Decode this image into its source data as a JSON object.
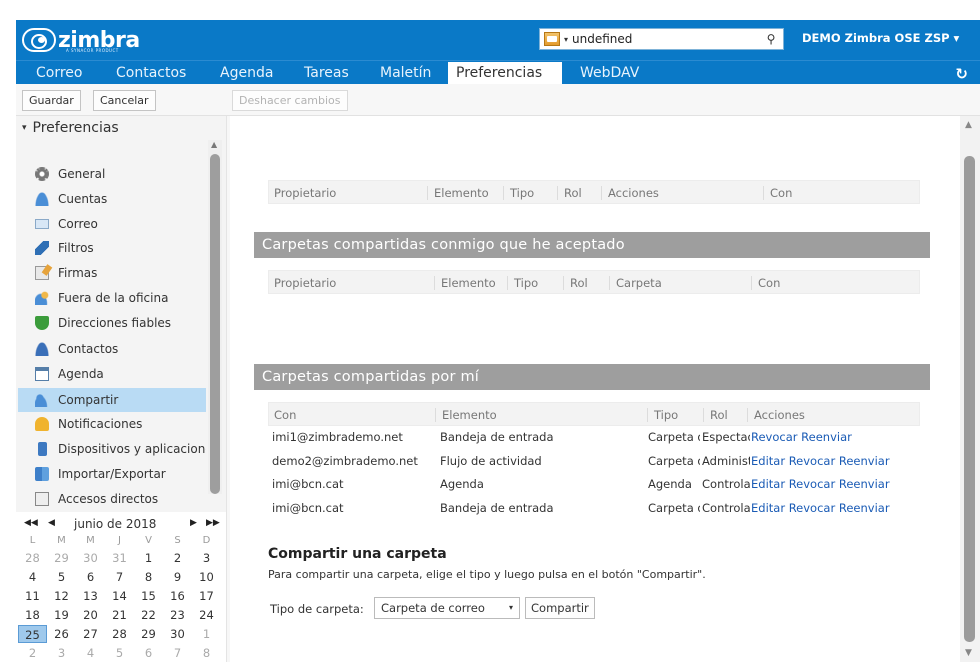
{
  "header": {
    "logo_text": "zimbra",
    "logo_sub": "A SYNACOR PRODUCT",
    "search_value": "undefined",
    "user": "DEMO Zimbra OSE ZSP",
    "user_caret": "▾",
    "refresh_glyph": "↻",
    "search_caret": "▾",
    "search_icon": "⚲"
  },
  "tabs": [
    "Correo",
    "Contactos",
    "Agenda",
    "Tareas",
    "Maletín",
    "Preferencias",
    "WebDAV"
  ],
  "toolbar": {
    "save": "Guardar",
    "cancel": "Cancelar",
    "undo": "Deshacer cambios"
  },
  "sidebar": {
    "root_arrow": "▾",
    "root": "Preferencias",
    "items": [
      {
        "label": "General",
        "icon": "gear-icon"
      },
      {
        "label": "Cuentas",
        "icon": "accounts-icon"
      },
      {
        "label": "Correo",
        "icon": "mail-icon"
      },
      {
        "label": "Filtros",
        "icon": "filter-icon"
      },
      {
        "label": "Firmas",
        "icon": "signature-icon"
      },
      {
        "label": "Fuera de la oficina",
        "icon": "out-of-office-icon"
      },
      {
        "label": "Direcciones fiables",
        "icon": "shield-icon"
      },
      {
        "label": "Contactos",
        "icon": "contacts-icon"
      },
      {
        "label": "Agenda",
        "icon": "calendar-icon"
      },
      {
        "label": "Compartir",
        "icon": "share-icon"
      },
      {
        "label": "Notificaciones",
        "icon": "bell-icon"
      },
      {
        "label": "Dispositivos y aplicaciones",
        "icon": "mobile-icon"
      },
      {
        "label": "Importar/Exportar",
        "icon": "import-export-icon"
      },
      {
        "label": "Accesos directos",
        "icon": "shortcuts-icon"
      }
    ],
    "scroll_up": "▲"
  },
  "minical": {
    "month": "junio de 2018",
    "prev_year": "◀◀",
    "prev_month": "◀",
    "next_month": "▶",
    "next_year": "▶▶",
    "weekdays": [
      "L",
      "M",
      "M",
      "J",
      "V",
      "S",
      "D"
    ],
    "weeks": [
      [
        {
          "d": "28",
          "om": true
        },
        {
          "d": "29",
          "om": true
        },
        {
          "d": "30",
          "om": true
        },
        {
          "d": "31",
          "om": true
        },
        {
          "d": "1"
        },
        {
          "d": "2"
        },
        {
          "d": "3"
        }
      ],
      [
        {
          "d": "4"
        },
        {
          "d": "5"
        },
        {
          "d": "6"
        },
        {
          "d": "7"
        },
        {
          "d": "8"
        },
        {
          "d": "9"
        },
        {
          "d": "10"
        }
      ],
      [
        {
          "d": "11"
        },
        {
          "d": "12"
        },
        {
          "d": "13"
        },
        {
          "d": "14"
        },
        {
          "d": "15"
        },
        {
          "d": "16"
        },
        {
          "d": "17"
        }
      ],
      [
        {
          "d": "18"
        },
        {
          "d": "19"
        },
        {
          "d": "20"
        },
        {
          "d": "21"
        },
        {
          "d": "22"
        },
        {
          "d": "23"
        },
        {
          "d": "24"
        }
      ],
      [
        {
          "d": "25",
          "today": true
        },
        {
          "d": "26"
        },
        {
          "d": "27"
        },
        {
          "d": "28"
        },
        {
          "d": "29"
        },
        {
          "d": "30"
        },
        {
          "d": "1",
          "om": true
        }
      ],
      [
        {
          "d": "2",
          "om": true
        },
        {
          "d": "3",
          "om": true
        },
        {
          "d": "4",
          "om": true
        },
        {
          "d": "5",
          "om": true
        },
        {
          "d": "6",
          "om": true
        },
        {
          "d": "7",
          "om": true
        },
        {
          "d": "8",
          "om": true
        }
      ]
    ]
  },
  "main": {
    "table1_headers": [
      "Propietario",
      "Elemento",
      "Tipo",
      "Rol",
      "Acciones",
      "Con"
    ],
    "section_accepted": "Carpetas compartidas conmigo que he aceptado",
    "table2_headers": [
      "Propietario",
      "Elemento",
      "Tipo",
      "Rol",
      "Carpeta",
      "Con"
    ],
    "section_mine": "Carpetas compartidas por mí",
    "table3_headers": [
      "Con",
      "Elemento",
      "Tipo",
      "Rol",
      "Acciones"
    ],
    "shares": [
      {
        "with": "imi1@zimbrademo.net",
        "item": "Bandeja de entrada",
        "type": "Carpeta de correo",
        "role": "Espectador",
        "actions": [
          "Revocar",
          "Reenviar"
        ]
      },
      {
        "with": "demo2@zimbrademo.net",
        "item": "Flujo de actividad",
        "type": "Carpeta de correo",
        "role": "Administrador",
        "actions": [
          "Editar",
          "Revocar",
          "Reenviar"
        ]
      },
      {
        "with": "imi@bcn.cat",
        "item": "Agenda",
        "type": "Agenda",
        "role": "Controlador",
        "actions": [
          "Editar",
          "Revocar",
          "Reenviar"
        ]
      },
      {
        "with": "imi@bcn.cat",
        "item": "Bandeja de entrada",
        "type": "Carpeta de correo",
        "role": "Controlador",
        "actions": [
          "Editar",
          "Revocar",
          "Reenviar"
        ]
      }
    ],
    "share_title": "Compartir una carpeta",
    "share_desc": "Para compartir una carpeta, elige el tipo y luego pulsa en el botón \"Compartir\".",
    "folder_type_label": "Tipo de carpeta:",
    "folder_type_value": "Carpeta de correo",
    "folder_type_caret": "▾",
    "share_button": "Compartir"
  },
  "scrollbar": {
    "up": "▲",
    "down": "▼"
  }
}
